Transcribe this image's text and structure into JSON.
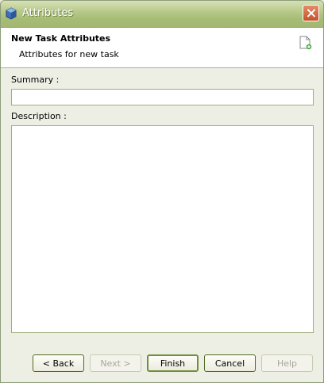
{
  "window": {
    "title": "Attributes",
    "close_icon": "close-icon"
  },
  "header": {
    "title": "New Task Attributes",
    "subtitle": "Attributes for new task",
    "icon": "new-task-icon"
  },
  "form": {
    "summary_label": "Summary :",
    "summary_value": "",
    "description_label": "Description :",
    "description_value": ""
  },
  "buttons": {
    "back": "< Back",
    "next": "Next >",
    "finish": "Finish",
    "cancel": "Cancel",
    "help": "Help"
  }
}
